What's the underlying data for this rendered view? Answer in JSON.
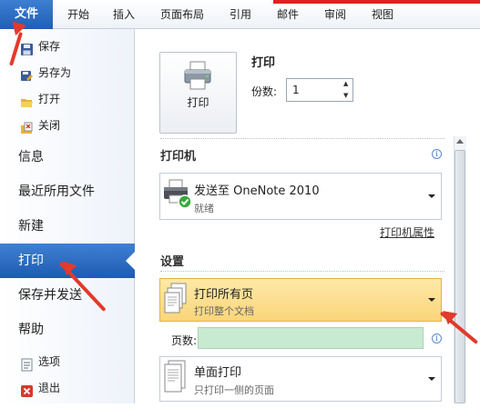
{
  "ribbon": {
    "file": "文件",
    "tabs": [
      "开始",
      "插入",
      "页面布局",
      "引用",
      "邮件",
      "审阅",
      "视图"
    ]
  },
  "nav": {
    "small_top": [
      {
        "label": "保存",
        "icon": "save-icon"
      },
      {
        "label": "另存为",
        "icon": "save-as-icon"
      },
      {
        "label": "打开",
        "icon": "open-folder-icon"
      },
      {
        "label": "关闭",
        "icon": "close-document-icon"
      }
    ],
    "big": [
      "信息",
      "最近所用文件",
      "新建",
      "打印",
      "保存并发送",
      "帮助"
    ],
    "selected": "打印",
    "small_bottom": [
      {
        "label": "选项",
        "icon": "options-icon"
      },
      {
        "label": "退出",
        "icon": "exit-icon"
      }
    ]
  },
  "print": {
    "heading": "打印",
    "button_label": "打印",
    "copies_label": "份数:",
    "copies_value": "1"
  },
  "printer": {
    "heading": "打印机",
    "name": "发送至 OneNote 2010",
    "status": "就绪",
    "properties_link": "打印机属性"
  },
  "settings": {
    "heading": "设置",
    "range_title": "打印所有页",
    "range_sub": "打印整个文档",
    "pages_label": "页数:",
    "pages_value": "",
    "sides_title": "单面打印",
    "sides_sub": "只打印一侧的页面"
  },
  "colors": {
    "accent_blue": "#1f5fb6",
    "highlight": "#fad57a",
    "annotation_red": "#e23a2b",
    "pages_input_bg": "#c8ead1"
  }
}
